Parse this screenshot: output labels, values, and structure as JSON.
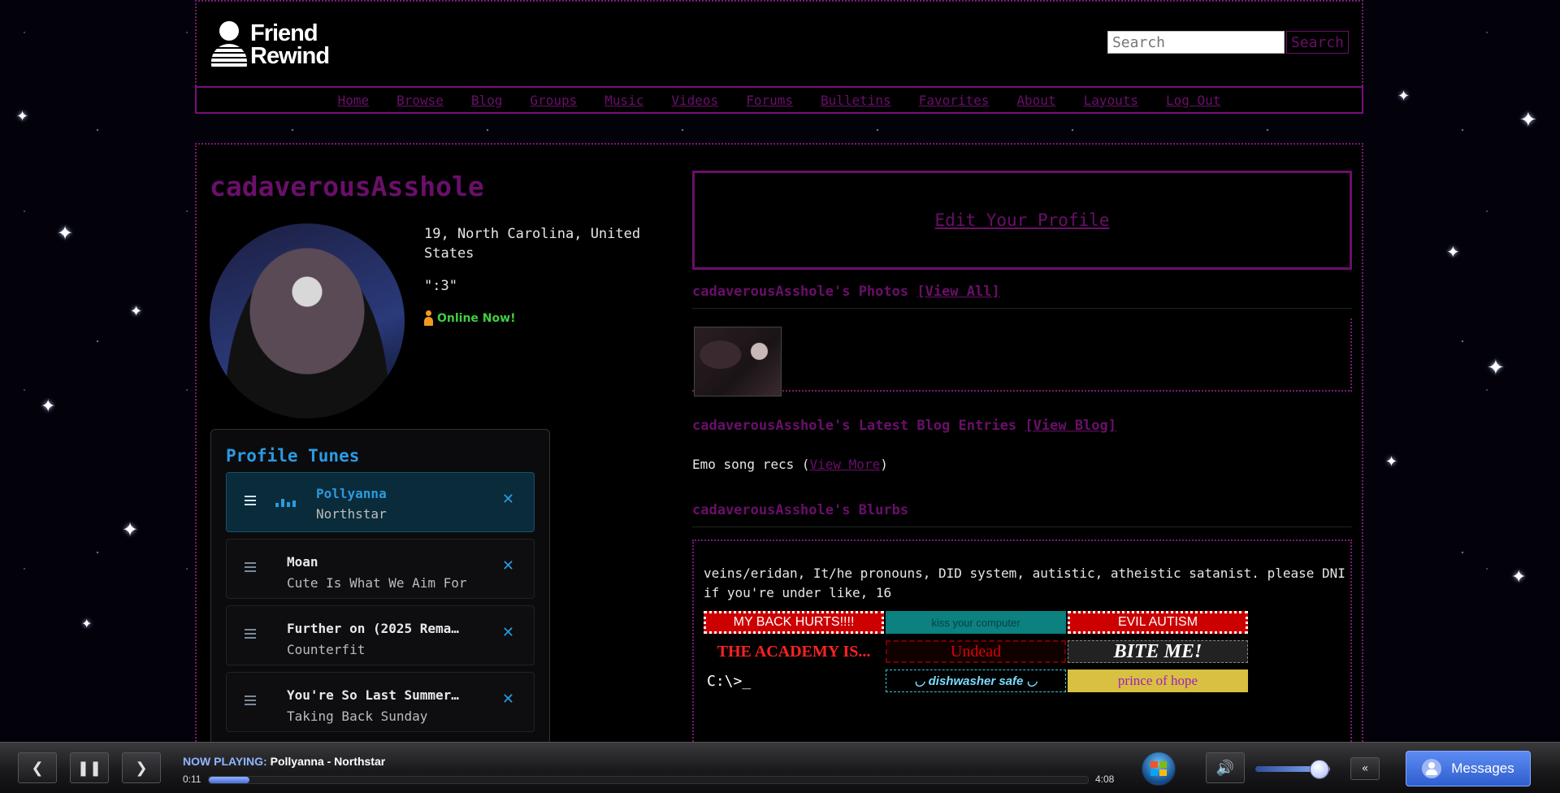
{
  "header": {
    "logo_line1": "Friend",
    "logo_line2": "Rewind",
    "search_placeholder": "Search",
    "search_button": "Search"
  },
  "nav": [
    "Home",
    "Browse",
    "Blog",
    "Groups",
    "Music",
    "Videos",
    "Forums",
    "Bulletins",
    "Favorites",
    "About",
    "Layouts",
    "Log Out"
  ],
  "profile": {
    "username": "cadaverousAsshole",
    "location": "19, North Carolina, United States",
    "status": "\":3\"",
    "online": "Online Now!"
  },
  "tunes": {
    "heading": "Profile Tunes",
    "items": [
      {
        "title": "Pollyanna",
        "artist": "Northstar"
      },
      {
        "title": "Moan",
        "artist": "Cute Is What We Aim For"
      },
      {
        "title": "Further on (2025 Rema…",
        "artist": "Counterfit"
      },
      {
        "title": "You're So Last Summer…",
        "artist": "Taking Back Sunday"
      }
    ]
  },
  "right": {
    "edit_profile": "Edit Your Profile",
    "photos_heading": "cadaverousAsshole's Photos",
    "photos_link": "[View All]",
    "blog_heading": "cadaverousAsshole's Latest Blog Entries",
    "blog_link": "[View Blog]",
    "blog_entry_title": "Emo song recs (",
    "blog_entry_link": "View More",
    "blog_entry_close": ")",
    "blurbs_heading": "cadaverousAsshole's Blurbs",
    "blurb_text": "veins/eridan, It/he pronouns, DID system, autistic, atheistic satanist. please DNI if you're under like, 16"
  },
  "stamps": [
    "MY BACK HURTS!!!!",
    "kiss your computer",
    "EVIL AUTISM",
    "THE ACADEMY IS...",
    "Undead",
    "BITE ME!",
    "C:\\>_",
    "◡ dishwasher safe ◡",
    "prince of hope"
  ],
  "player": {
    "now_playing_label": "NOW PLAYING:",
    "now_playing_value": "Pollyanna - Northstar",
    "current_time": "0:11",
    "total_time": "4:08",
    "progress": 0.044,
    "volume": 0.85,
    "collapse_label": "«",
    "messages_label": "Messages"
  },
  "colors": {
    "accent": "#6a0f6a",
    "tunes_accent": "#2a9be0",
    "online": "#3fcf3f"
  }
}
